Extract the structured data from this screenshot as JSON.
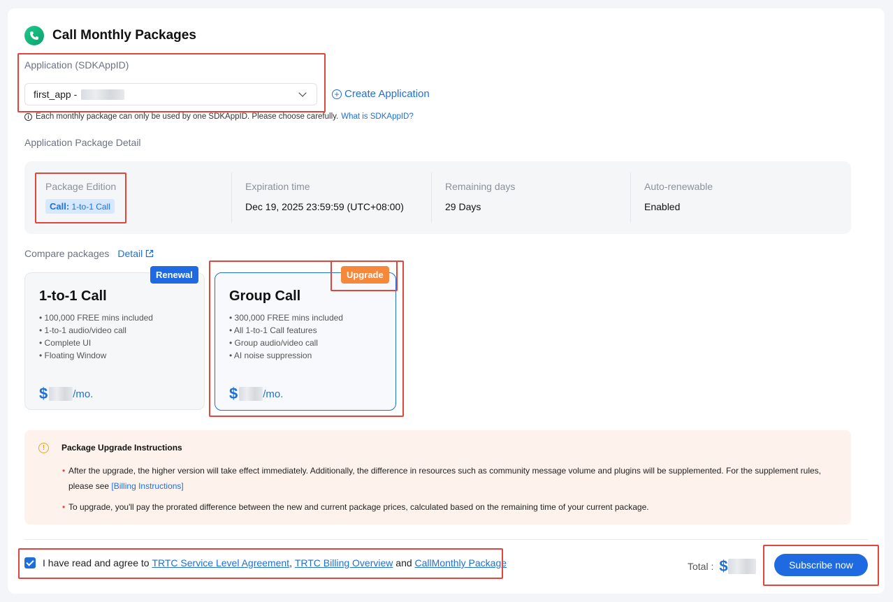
{
  "header": {
    "title": "Call Monthly Packages",
    "logo_icon": "phone-logo-icon"
  },
  "application": {
    "label": "Application (SDKAppID)",
    "selected_value": "first_app -",
    "create_label": "Create Application",
    "note": "Each monthly package can only be used by one SDKAppID. Please choose carefully.",
    "note_link": "What is SDKAppID?"
  },
  "detail": {
    "section_label": "Application Package Detail",
    "edition_label": "Package Edition",
    "edition_tag_bold": "Call:",
    "edition_tag_text": "1-to-1 Call",
    "expiration_label": "Expiration time",
    "expiration_value": "Dec 19, 2025 23:59:59 (UTC+08:00)",
    "remaining_label": "Remaining days",
    "remaining_value": "29 Days",
    "auto_label": "Auto-renewable",
    "auto_value": "Enabled"
  },
  "compare": {
    "label": "Compare packages",
    "detail_link": "Detail"
  },
  "packages": [
    {
      "name": "1-to-1 Call",
      "ribbon": "Renewal",
      "features": [
        "100,000 FREE mins included",
        "1-to-1 audio/video call",
        "Complete UI",
        "Floating Window"
      ],
      "price_symbol": "$",
      "price_suffix": "/mo."
    },
    {
      "name": "Group Call",
      "ribbon": "Upgrade",
      "features": [
        "300,000 FREE mins included",
        "All 1-to-1 Call features",
        "Group audio/video call",
        "AI noise suppression"
      ],
      "price_symbol": "$",
      "price_suffix": "/mo."
    }
  ],
  "upgrade_instructions": {
    "title": "Package Upgrade Instructions",
    "item1": "After the upgrade, the higher version will take effect immediately. Additionally, the difference in resources such as community message volume and plugins will be supplemented. For the supplement rules, please see",
    "item1_link": "[Billing Instructions]",
    "item2": "To upgrade, you'll pay the prorated difference between the new and current package prices, calculated based on the remaining time of your current package."
  },
  "footer": {
    "agree_prefix": "I have read and agree to",
    "link1": "TRTC Service Level Agreement",
    "sep": ",",
    "link2": "TRTC Billing Overview",
    "and": "and",
    "link3": "CallMonthly Package",
    "total_label": "Total :",
    "total_symbol": "$",
    "subscribe": "Subscribe now"
  },
  "colors": {
    "accent": "#1f6fd6",
    "highlight": "#e0463c",
    "upgrade_ribbon": "#f5883a",
    "renewal_ribbon": "#1f6ae0"
  }
}
